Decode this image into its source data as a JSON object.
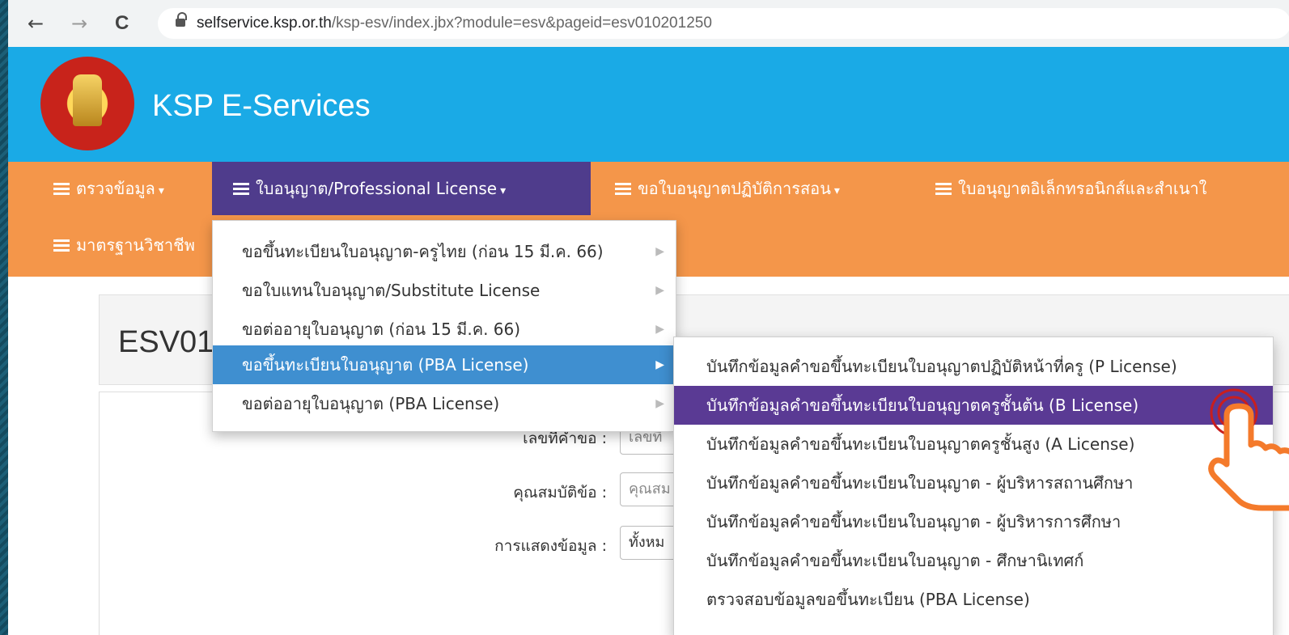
{
  "browser": {
    "nav": {
      "back": "←",
      "forward": "→",
      "reload": "C"
    },
    "url_host": "selfservice.ksp.or.th",
    "url_path": "/ksp-esv/index.jbx?module=esv&pageid=esv010201250"
  },
  "header": {
    "brand": "KSP E-Services"
  },
  "menubar": {
    "items": [
      {
        "label": "ตรวจข้อมูล"
      },
      {
        "label": "ใบอนุญาต/Professional License"
      },
      {
        "label": "ขอใบอนุญาตปฏิบัติการสอน"
      },
      {
        "label": "ใบอนุญาตอิเล็กทรอนิกส์และสำเนาใ"
      },
      {
        "label": "มาตรฐานวิชาชีพ"
      }
    ]
  },
  "dropdown": {
    "items": [
      {
        "label": "ขอขึ้นทะเบียนใบอนุญาต-ครูไทย (ก่อน 15 มี.ค. 66)"
      },
      {
        "label": "ขอใบแทนใบอนุญาต/Substitute License"
      },
      {
        "label": "ขอต่ออายุใบอนุญาต (ก่อน 15 มี.ค. 66)"
      },
      {
        "label": "ขอขึ้นทะเบียนใบอนุญาต (PBA License)"
      },
      {
        "label": "ขอต่ออายุใบอนุญาต (PBA License)"
      }
    ]
  },
  "submenu": {
    "items": [
      {
        "label": "บันทึกข้อมูลคำขอขึ้นทะเบียนใบอนุญาตปฏิบัติหน้าที่ครู (P License)"
      },
      {
        "label": "บันทึกข้อมูลคำขอขึ้นทะเบียนใบอนุญาตครูชั้นต้น (B License)"
      },
      {
        "label": "บันทึกข้อมูลคำขอขึ้นทะเบียนใบอนุญาตครูชั้นสูง (A License)"
      },
      {
        "label": "บันทึกข้อมูลคำขอขึ้นทะเบียนใบอนุญาต - ผู้บริหารสถานศึกษา"
      },
      {
        "label": "บันทึกข้อมูลคำขอขึ้นทะเบียนใบอนุญาต - ผู้บริหารการศึกษา"
      },
      {
        "label": "บันทึกข้อมูลคำขอขึ้นทะเบียนใบอนุญาต - ศึกษานิเทศก์"
      },
      {
        "label": "ตรวจสอบข้อมูลขอขึ้นทะเบียน (PBA License)"
      }
    ]
  },
  "page": {
    "title": "ESV01",
    "form": {
      "request_no_label": "เลขที่คำขอ :",
      "request_no_placeholder": "เลขที",
      "qualification_label": "คุณสมบัติข้อ :",
      "qualification_placeholder": "คุณสม",
      "display_label": "การแสดงข้อมูล :",
      "display_value": "ทั้งหม"
    }
  },
  "colors": {
    "header_bg": "#1aaae6",
    "menubar_bg": "#f4964a",
    "menu_active_bg": "#4f3c8c",
    "dropdown_highlight": "#3f8fd0",
    "submenu_active": "#5a3a94",
    "pointer": "#f47a2b"
  },
  "icons": [
    "back-arrow-icon",
    "forward-arrow-icon",
    "reload-icon",
    "lock-icon",
    "menu-list-icon",
    "caret-down-icon",
    "chevron-right-icon",
    "hand-pointer-icon",
    "seal-logo-icon"
  ]
}
